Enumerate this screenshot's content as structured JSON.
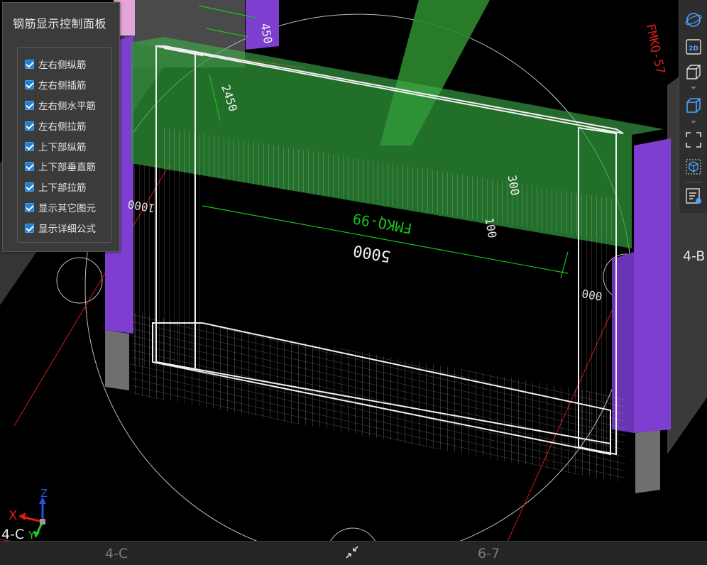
{
  "panel": {
    "title": "钢筋显示控制面板",
    "options": [
      {
        "label": "左右侧纵筋",
        "checked": true
      },
      {
        "label": "左右侧插筋",
        "checked": true
      },
      {
        "label": "左右侧水平筋",
        "checked": true
      },
      {
        "label": "左右侧拉筋",
        "checked": true
      },
      {
        "label": "上下部纵筋",
        "checked": true
      },
      {
        "label": "上下部垂直筋",
        "checked": true
      },
      {
        "label": "上下部拉筋",
        "checked": true
      },
      {
        "label": "显示其它图元",
        "checked": true
      },
      {
        "label": "显示详细公式",
        "checked": true
      }
    ]
  },
  "toolbar": {
    "items": [
      "orbit-icon",
      "2d-view-icon",
      "3d-box-icon",
      "3d-box-filled-icon",
      "fit-view-icon",
      "iso-view-icon",
      "properties-icon"
    ],
    "view_2d_label": "2D"
  },
  "model": {
    "frame_label": "FMKQ-99",
    "frame_label_top": "FMKQ-57",
    "dim_width": "5000",
    "dim_450": "450",
    "dim_2450": "2450",
    "dim_300": "300",
    "dim_100": "100",
    "dim_left": "1000",
    "dim_right": "000"
  },
  "grid": {
    "axis_4b": "4-B",
    "axis_4c": "4-C",
    "axis_4c_bottom": "4-C",
    "axis_67": "6-7"
  },
  "axes": {
    "x": "X",
    "y": "Y",
    "z": "Z"
  },
  "colors": {
    "beam_green": "#2f9a3a",
    "column_purple": "#7e3fd0",
    "concrete_grey": "#6f6f6f",
    "rebar_white": "#d8d8d8",
    "dim_green": "#18c418",
    "axis_red": "#e01a1a",
    "accent_blue": "#4aa3ff"
  }
}
